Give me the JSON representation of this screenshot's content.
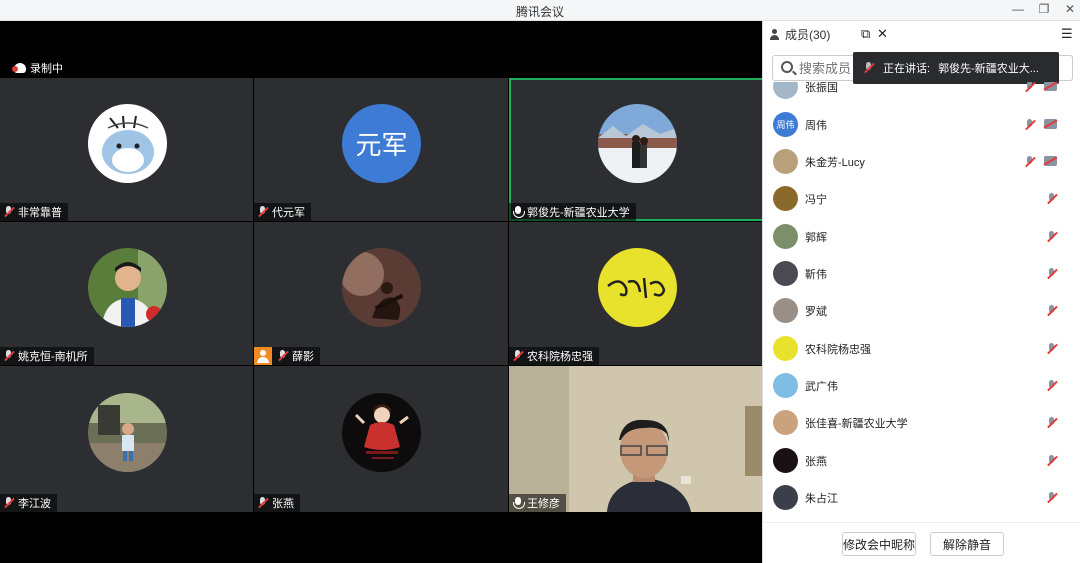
{
  "window": {
    "title": "腾讯会议"
  },
  "recording": {
    "label": "录制中"
  },
  "tiles": [
    {
      "name": "非常靠普",
      "mic": "off",
      "active": false,
      "avatar": "cartoon-bird"
    },
    {
      "name": "代元军",
      "mic": "off",
      "active": false,
      "avatar": "text",
      "avatar_text": "元军"
    },
    {
      "name": "郭俊先-新疆农业大学",
      "mic": "on",
      "active": true,
      "avatar": "photo-snow"
    },
    {
      "name": "姚克恒-南机所",
      "mic": "off",
      "active": false,
      "avatar": "photo-boy"
    },
    {
      "name": "薛影",
      "mic": "off",
      "active": false,
      "avatar": "photo-guitar",
      "badge": "user"
    },
    {
      "name": "农科院杨忠强",
      "mic": "off",
      "active": false,
      "avatar": "calligraphy"
    },
    {
      "name": "李江波",
      "mic": "off",
      "active": false,
      "avatar": "photo-child"
    },
    {
      "name": "张燕",
      "mic": "off",
      "active": false,
      "avatar": "illustration-girl"
    },
    {
      "name": "王修彦",
      "mic": "on",
      "active": false,
      "avatar": "video"
    }
  ],
  "panel": {
    "members_label": "成员(30)",
    "search_placeholder": "搜索成员",
    "speaking_label": "正在讲话:",
    "speaking_name": "郭俊先-新疆农业大..."
  },
  "members": [
    {
      "name": "张振国",
      "avatar": "photo",
      "mic": "off",
      "cam": "off",
      "partial": true
    },
    {
      "name": "周伟",
      "avatar": "text",
      "avatar_text": "周伟",
      "mic": "off",
      "cam": "off"
    },
    {
      "name": "朱金芳-Lucy",
      "avatar": "photo",
      "mic": "off",
      "cam": "off"
    },
    {
      "name": "冯宁",
      "avatar": "photo",
      "mic": "off"
    },
    {
      "name": "郭辉",
      "avatar": "photo",
      "mic": "off"
    },
    {
      "name": "靳伟",
      "avatar": "photo",
      "mic": "off"
    },
    {
      "name": "罗斌",
      "avatar": "photo",
      "mic": "off"
    },
    {
      "name": "农科院杨忠强",
      "avatar": "calligraphy",
      "mic": "off"
    },
    {
      "name": "武广伟",
      "avatar": "photo",
      "mic": "off"
    },
    {
      "name": "张佳喜-新疆农业大学",
      "avatar": "photo",
      "mic": "off"
    },
    {
      "name": "张燕",
      "avatar": "illustration",
      "mic": "off"
    },
    {
      "name": "朱占江",
      "avatar": "photo",
      "mic": "off"
    }
  ],
  "footer": {
    "rename_label": "修改会中昵称",
    "unmute_label": "解除静音"
  },
  "colors": {
    "accent": "#1fae5a",
    "tile_bg": "#2c2e31",
    "avatar_blue": "#3d7bd4"
  }
}
